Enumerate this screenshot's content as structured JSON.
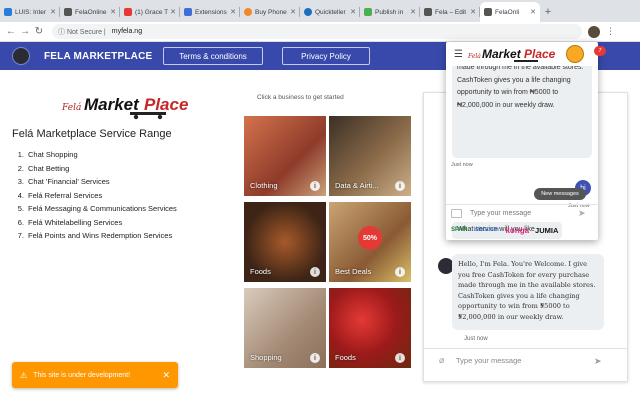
{
  "browser": {
    "tabs": [
      {
        "title": "LUIS: Inter",
        "favicon_color": "#2b7bd8"
      },
      {
        "title": "FelaOnline",
        "favicon_color": "#555555"
      },
      {
        "title": "(1) Grace T",
        "favicon_color": "#e53935"
      },
      {
        "title": "Extensions",
        "favicon_color": "#3f6fd8"
      },
      {
        "title": "Buy Phone",
        "favicon_color": "#f0892a"
      },
      {
        "title": "Quickteller",
        "favicon_color": "#1c6ec0"
      },
      {
        "title": "Publish in",
        "favicon_color": "#4caf50"
      },
      {
        "title": "Fela – Edit",
        "favicon_color": "#555555"
      },
      {
        "title": "FelaOnli",
        "favicon_color": "#555555"
      }
    ],
    "address": {
      "security": "Not Secure",
      "url": "myfela.ng"
    }
  },
  "header": {
    "brand": "FELA MARKETPLACE",
    "terms_label": "Terms & conditions",
    "privacy_label": "Privacy Policy",
    "bg_color": "#3949ab"
  },
  "left": {
    "logo_text": "Felá MarketPlace",
    "title": "Felá Marketplace Service Range",
    "services": [
      "Chat Shopping",
      "Chat Betting",
      "Chat 'Financial' Services",
      "Felá Referral Services",
      "Felá Messaging & Communications Services",
      "Felá Whitelabelling Services",
      "Felá Points and Wins Redemption Services"
    ]
  },
  "businesses": {
    "hint": "Click a business to get started",
    "tiles": [
      {
        "label": "Clothing",
        "color": "#b5553c"
      },
      {
        "label": "Data & Airti...",
        "color": "#6b5a45"
      },
      {
        "label": "Foods",
        "color": "#6b3a22"
      },
      {
        "label": "Best Deals",
        "color": "#a97a4d"
      },
      {
        "label": "Shopping",
        "color": "#b39b8a"
      },
      {
        "label": "Foods",
        "color": "#b21f1f"
      }
    ],
    "deal_badge": "50%"
  },
  "chat_main": {
    "message": "Hello, I'm Fela. You're Welcome. I give you free CashToken for every purchase made through me in the available stores. CashToken gives you a life changing opportunity to win from ₦5000 to ₦2,000,000 in our weekly draw.",
    "time": "Just now",
    "input_placeholder": "Type your message"
  },
  "popup": {
    "logo_text": "Felá MarketPlace",
    "message_visible": "made through me in the available stores. CashToken gives you a life changing opportunity to win from ₦5000 to ₦2,000,000 in our weekly draw.",
    "time1": "Just now",
    "user_reply": "hi",
    "time2": "Just now",
    "question": "What service will you like",
    "new_messages": "New messages",
    "input_placeholder": "Type your message",
    "partners": [
      "SPAR",
      "Wakanow",
      "konga",
      "JUMIA"
    ],
    "badge_count": "7"
  },
  "toast": {
    "text": "This site is under development!"
  }
}
